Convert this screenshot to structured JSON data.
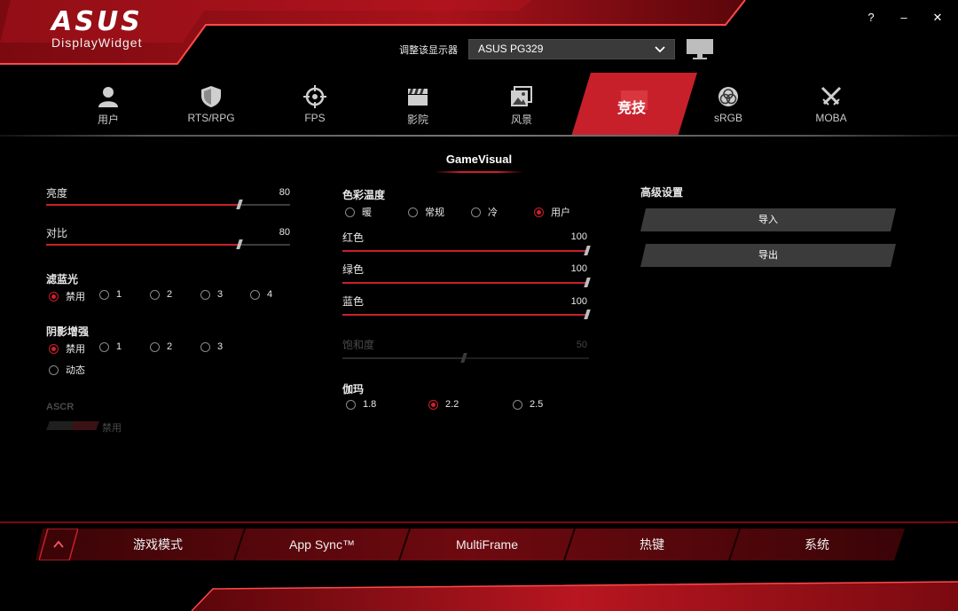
{
  "app": {
    "logo_wordmark": "ASUS",
    "logo_sub": "DisplayWidget",
    "help_label": "?",
    "minimize_label": "–",
    "close_label": "✕",
    "accent_color": "#c8202a"
  },
  "monitor": {
    "label": "调整该显示器",
    "selected": "ASUS PG329",
    "icon": "monitor-icon"
  },
  "tabs": [
    {
      "label": "用户",
      "icon": "user-icon"
    },
    {
      "label": "RTS/RPG",
      "icon": "shield-icon"
    },
    {
      "label": "FPS",
      "icon": "crosshair-icon"
    },
    {
      "label": "影院",
      "icon": "clapperboard-icon"
    },
    {
      "label": "风景",
      "icon": "landscape-icon"
    },
    {
      "label": "竞技",
      "icon": "racing-icon",
      "active": true
    },
    {
      "label": "sRGB",
      "icon": "rgb-circles-icon"
    },
    {
      "label": "MOBA",
      "icon": "crossed-swords-icon"
    }
  ],
  "profile_title": "GameVisual",
  "left": {
    "brightness": {
      "label": "亮度",
      "value": 80,
      "max": 100
    },
    "contrast": {
      "label": "对比",
      "value": 80,
      "max": 100
    },
    "blue_light": {
      "label": "滤蓝光",
      "options": [
        "禁用",
        "1",
        "2",
        "3",
        "4"
      ],
      "selected": "禁用"
    },
    "shadow_boost": {
      "label": "阴影增强",
      "options": [
        "禁用",
        "1",
        "2",
        "3",
        "动态"
      ],
      "selected": "禁用"
    },
    "ascr": {
      "label": "ASCR",
      "state_label": "禁用",
      "enabled": false
    }
  },
  "middle": {
    "color_temp": {
      "label": "色彩温度",
      "options": [
        "暖",
        "常规",
        "冷",
        "用户"
      ],
      "selected": "用户"
    },
    "red": {
      "label": "红色",
      "value": 100,
      "max": 100
    },
    "green": {
      "label": "绿色",
      "value": 100,
      "max": 100
    },
    "blue": {
      "label": "蓝色",
      "value": 100,
      "max": 100
    },
    "saturation": {
      "label": "饱和度",
      "value": 50,
      "max": 100,
      "enabled": false
    },
    "gamma": {
      "label": "伽玛",
      "options": [
        "1.8",
        "2.2",
        "2.5"
      ],
      "selected": "2.2"
    }
  },
  "right": {
    "advanced_label": "高级设置",
    "import_label": "导入",
    "export_label": "导出"
  },
  "bottom_nav": [
    "游戏模式",
    "App Sync™",
    "MultiFrame",
    "热键",
    "系统"
  ]
}
